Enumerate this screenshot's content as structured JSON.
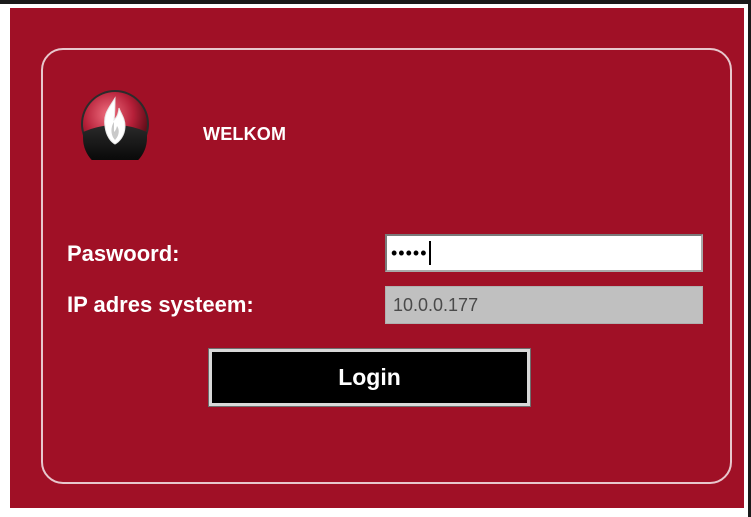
{
  "header": {
    "welcome_text": "WELKOM"
  },
  "form": {
    "password_label": "Paswoord:",
    "password_value_masked": "•••••",
    "ip_label": "IP adres systeem:",
    "ip_value": "10.0.0.177",
    "login_label": "Login"
  },
  "icons": {
    "logo": "flame-logo-icon"
  },
  "colors": {
    "background": "#a01026",
    "panel_border": "#e8c7cd",
    "ip_field_bg": "#c0c0c0",
    "button_bg": "#000000",
    "text": "#ffffff"
  }
}
